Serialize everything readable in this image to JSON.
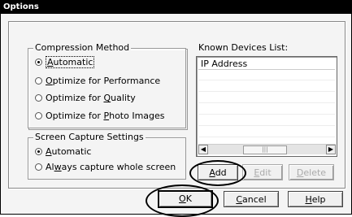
{
  "window": {
    "title": "Options"
  },
  "compression": {
    "label": "Compression Method",
    "options": [
      {
        "prefix": "",
        "mnemonic": "A",
        "rest": "utomatic",
        "selected": true
      },
      {
        "prefix": "",
        "mnemonic": "O",
        "rest": "ptimize for Performance",
        "selected": false
      },
      {
        "prefix": "Optimize for ",
        "mnemonic": "Q",
        "rest": "uality",
        "selected": false
      },
      {
        "prefix": "Optimize for ",
        "mnemonic": "P",
        "rest": "hoto Images",
        "selected": false
      }
    ]
  },
  "capture": {
    "label": "Screen Capture Settings",
    "options": [
      {
        "prefix": "",
        "mnemonic": "A",
        "rest": "utomatic",
        "selected": true
      },
      {
        "prefix": "Al",
        "mnemonic": "w",
        "rest": "ays capture whole screen",
        "selected": false
      }
    ]
  },
  "devices": {
    "label": "Known Devices List:",
    "column_header": "IP Address",
    "rows": []
  },
  "buttons": {
    "add": {
      "mnemonic": "A",
      "rest": "dd"
    },
    "edit": {
      "mnemonic": "E",
      "rest": "dit"
    },
    "delete": {
      "mnemonic": "D",
      "rest": "elete"
    },
    "ok": {
      "mnemonic": "O",
      "rest": "K"
    },
    "cancel": {
      "mnemonic": "C",
      "rest": "ancel"
    },
    "help": {
      "mnemonic": "H",
      "rest": "elp"
    }
  }
}
